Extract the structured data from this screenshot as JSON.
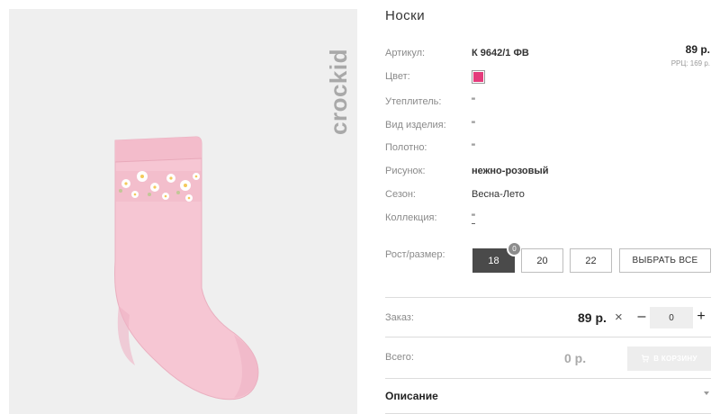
{
  "product": {
    "title": "Носки",
    "brand_logo_text": "crockid",
    "image_description_icon": "sock-icon"
  },
  "price": {
    "main": "89 р.",
    "rrc": "РРЦ: 169 р."
  },
  "attributes": {
    "article": {
      "label": "Артикул:",
      "value": "К 9642/1 ФВ"
    },
    "color": {
      "label": "Цвет:",
      "swatch": "#e43b7b"
    },
    "insulation": {
      "label": "Утеплитель:",
      "value": "\""
    },
    "product_type": {
      "label": "Вид изделия:",
      "value": "\""
    },
    "fabric": {
      "label": "Полотно:",
      "value": "\""
    },
    "pattern": {
      "label": "Рисунок:",
      "value": "нежно-розовый"
    },
    "season": {
      "label": "Сезон:",
      "value": "Весна-Лето"
    },
    "collection": {
      "label": "Коллекция:",
      "value": "\""
    }
  },
  "sizes": {
    "label": "Рост/размер:",
    "options": [
      "18",
      "20",
      "22"
    ],
    "selected": "18",
    "badge_count": "0",
    "select_all_label": "ВЫБРАТЬ ВСЕ"
  },
  "order": {
    "label": "Заказ:",
    "price": "89 р.",
    "remove_icon": "×",
    "minus": "–",
    "quantity": "0",
    "plus": "+"
  },
  "total": {
    "label": "Всего:",
    "value": "0 р.",
    "cart_button_label": "В КОРЗИНУ",
    "cart_icon": "cart-icon"
  },
  "description": {
    "label": "Описание",
    "toggle_icon": "chevron-down-icon"
  },
  "colors": {
    "accent_dark": "#4a4a4a",
    "swatch": "#e43b7b",
    "photo_bg": "#efefef",
    "sock_pink": "#f6c6d3"
  }
}
